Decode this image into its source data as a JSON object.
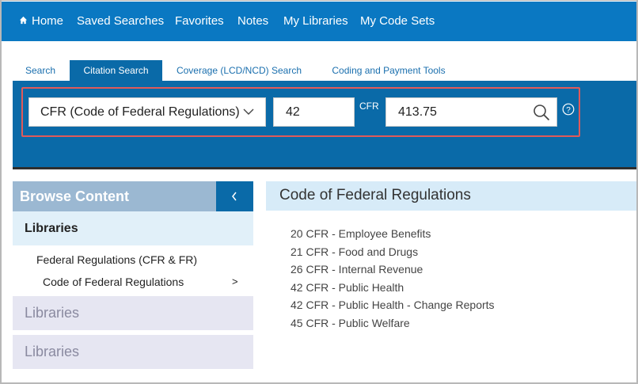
{
  "topnav": {
    "items": [
      "Home",
      "Saved Searches",
      "Favorites",
      "Notes",
      "My Libraries",
      "My Code Sets"
    ]
  },
  "tabs": [
    "Search",
    "Citation Search",
    "Coverage (LCD/NCD) Search",
    "Coding and Payment Tools"
  ],
  "active_tab": "Citation Search",
  "citation": {
    "source_select": "CFR (Code of Federal Regulations)",
    "title_value": "42",
    "separator_label": "CFR",
    "section_value": "413.75"
  },
  "sidebar": {
    "header": "Browse Content",
    "libraries_title": "Libraries",
    "links": [
      "Federal Regulations (CFR & FR)",
      "Code of Federal Regulations"
    ],
    "arrow": ">",
    "collapsed_blocks": [
      "Libraries",
      "Libraries"
    ]
  },
  "main": {
    "title": "Code of Federal Regulations",
    "items": [
      "20 CFR - Employee Benefits",
      "21 CFR - Food and Drugs",
      "26 CFR - Internal Revenue",
      "42 CFR - Public Health",
      "42 CFR - Public Health - Change Reports",
      "45 CFR - Public Welfare"
    ]
  },
  "colors": {
    "nav_blue": "#0a78c2",
    "search_bar_blue": "#0a6aa8",
    "highlight_red": "#e05a5a"
  }
}
